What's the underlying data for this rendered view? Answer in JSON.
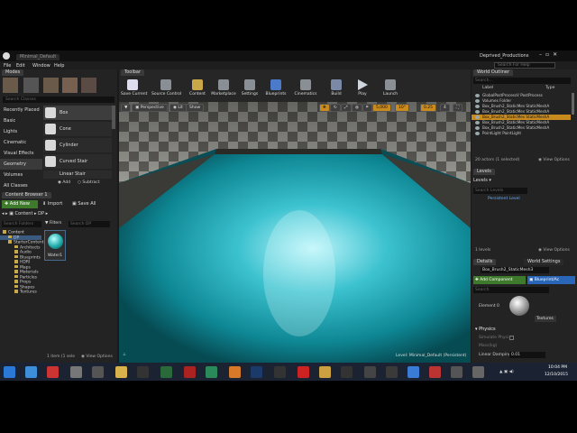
{
  "window": {
    "title": "Deprived_Productions",
    "tab": "Minimal_Default",
    "search_help_placeholder": "Search For Help"
  },
  "menu": [
    "File",
    "Edit",
    "Window",
    "Help"
  ],
  "modes": {
    "tab": "Modes",
    "search_placeholder": "Search Classes",
    "categories": [
      "Recently Placed",
      "Basic",
      "Lights",
      "Cinematic",
      "Visual Effects",
      "Geometry",
      "Volumes",
      "All Classes"
    ],
    "selected": "Geometry",
    "shapes": [
      "Box",
      "Cone",
      "Cylinder",
      "Curved Stair",
      "Linear Stair"
    ],
    "brush_add": "Add",
    "brush_subtract": "Subtract"
  },
  "toolbar": {
    "tab": "Toolbar",
    "buttons": [
      "Save Current",
      "Source Control",
      "Content",
      "Marketplace",
      "Settings",
      "Blueprints",
      "Cinematics",
      "Build",
      "Play",
      "Launch"
    ]
  },
  "viewport": {
    "perspective": "Perspective",
    "lit": "Lit",
    "show": "Show",
    "snap1": "5,000",
    "snap2": "10°",
    "snap3": "0.25",
    "cam": "4",
    "level_label": "Level: Minimal_Default (Persistent)"
  },
  "content_browser": {
    "tab": "Content Browser 1",
    "add_new": "Add New",
    "import": "Import",
    "save_all": "Save All",
    "path": [
      "Content",
      "DP"
    ],
    "search_folders": "Search Folders",
    "filters": "Filters",
    "search_dp": "Search DP",
    "tree": [
      "Content",
      "DP",
      "StarterContent",
      "Architects",
      "Audio",
      "Blueprints",
      "HDRI",
      "Maps",
      "Materials",
      "Particles",
      "Props",
      "Shapes",
      "Textures"
    ],
    "asset_name": "Water1",
    "status": "1 item (1 sele",
    "view_options": "View Options"
  },
  "outliner": {
    "tab": "World Outliner",
    "search_placeholder": "Search...",
    "col_label": "Label",
    "col_type": "Type",
    "rows": [
      {
        "label": "GlobalPostProcessV",
        "type": "PostProcess"
      },
      {
        "label": "Volumes",
        "type": "Folder"
      },
      {
        "label": "Box_Brush2_StaticMes",
        "type": "StaticMeshA"
      },
      {
        "label": "Box_Brush2_StaticMes",
        "type": "StaticMeshA"
      },
      {
        "label": "Box_Brush2_StaticMes",
        "type": "StaticMeshA"
      },
      {
        "label": "Box_Brush2_StaticMes",
        "type": "StaticMeshA"
      },
      {
        "label": "Box_Brush2_StaticMes",
        "type": "StaticMeshA"
      },
      {
        "label": "PointLight",
        "type": "PointLight"
      }
    ],
    "status": "20 actors (1 selected)",
    "view_options": "View Options"
  },
  "levels": {
    "tab": "Levels",
    "menu": "Levels",
    "search_placeholder": "Search Levels",
    "row": "Persistent Level",
    "status": "1 levels",
    "view_options": "View Options"
  },
  "details": {
    "tab": "Details",
    "tab2": "World Settings",
    "object": "Box_Brush2_StaticMesh3",
    "add_component": "Add Component",
    "blueprint": "Blueprint/Ac",
    "search_placeholder": "Search",
    "element": "Element 0",
    "textures": "Textures",
    "section": "Physics",
    "props": [
      "Simulate Physi",
      "Mass(kg)",
      "Linear Damping"
    ],
    "linear_damping_value": "0.01"
  },
  "taskbar": {
    "time": "10:04 PM",
    "date": "12/10/2015"
  }
}
